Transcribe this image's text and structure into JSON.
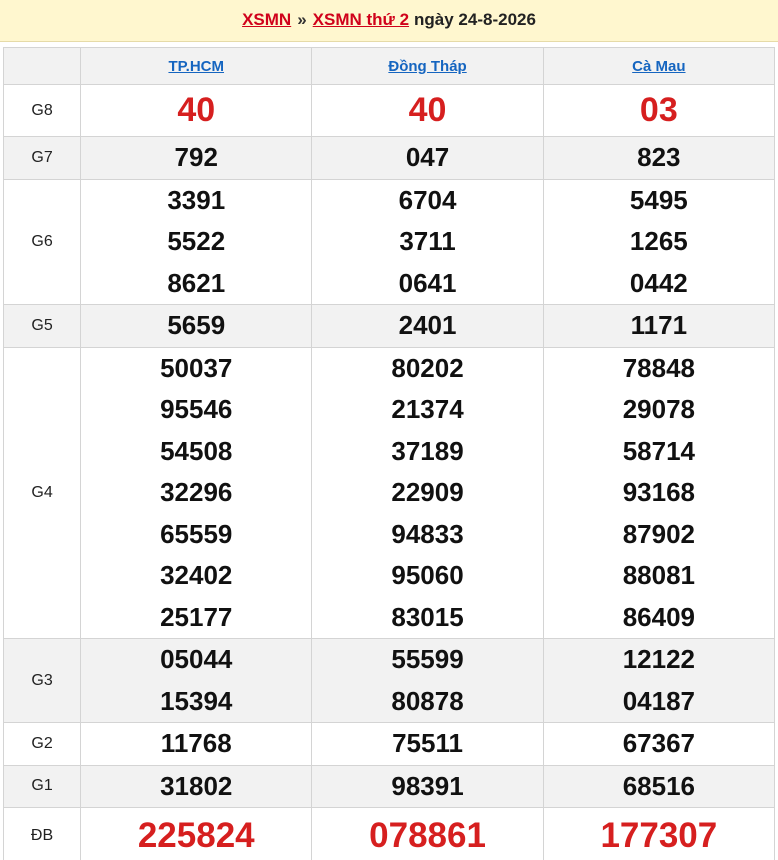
{
  "header": {
    "link1": "XSMN",
    "separator": "»",
    "link2": "XSMN thứ 2",
    "date_text": "ngày 24-8-2026"
  },
  "columns": [
    "TP.HCM",
    "Đồng Tháp",
    "Cà Mau"
  ],
  "prizes": [
    {
      "label": "G8",
      "values": [
        [
          "40"
        ],
        [
          "40"
        ],
        [
          "03"
        ]
      ]
    },
    {
      "label": "G7",
      "values": [
        [
          "792"
        ],
        [
          "047"
        ],
        [
          "823"
        ]
      ]
    },
    {
      "label": "G6",
      "values": [
        [
          "3391",
          "5522",
          "8621"
        ],
        [
          "6704",
          "3711",
          "0641"
        ],
        [
          "5495",
          "1265",
          "0442"
        ]
      ]
    },
    {
      "label": "G5",
      "values": [
        [
          "5659"
        ],
        [
          "2401"
        ],
        [
          "1171"
        ]
      ]
    },
    {
      "label": "G4",
      "values": [
        [
          "50037",
          "95546",
          "54508",
          "32296",
          "65559",
          "32402",
          "25177"
        ],
        [
          "80202",
          "21374",
          "37189",
          "22909",
          "94833",
          "95060",
          "83015"
        ],
        [
          "78848",
          "29078",
          "58714",
          "93168",
          "87902",
          "88081",
          "86409"
        ]
      ]
    },
    {
      "label": "G3",
      "values": [
        [
          "05044",
          "15394"
        ],
        [
          "55599",
          "80878"
        ],
        [
          "12122",
          "04187"
        ]
      ]
    },
    {
      "label": "G2",
      "values": [
        [
          "11768"
        ],
        [
          "75511"
        ],
        [
          "67367"
        ]
      ]
    },
    {
      "label": "G1",
      "values": [
        [
          "31802"
        ],
        [
          "98391"
        ],
        [
          "68516"
        ]
      ]
    },
    {
      "label": "ĐB",
      "values": [
        [
          "225824"
        ],
        [
          "078861"
        ],
        [
          "177307"
        ]
      ]
    }
  ],
  "colors": {
    "accent_red": "#d61f1f",
    "link_blue": "#1565c0",
    "header_bg": "#fff7cf",
    "row_gray": "#f2f2f2"
  }
}
